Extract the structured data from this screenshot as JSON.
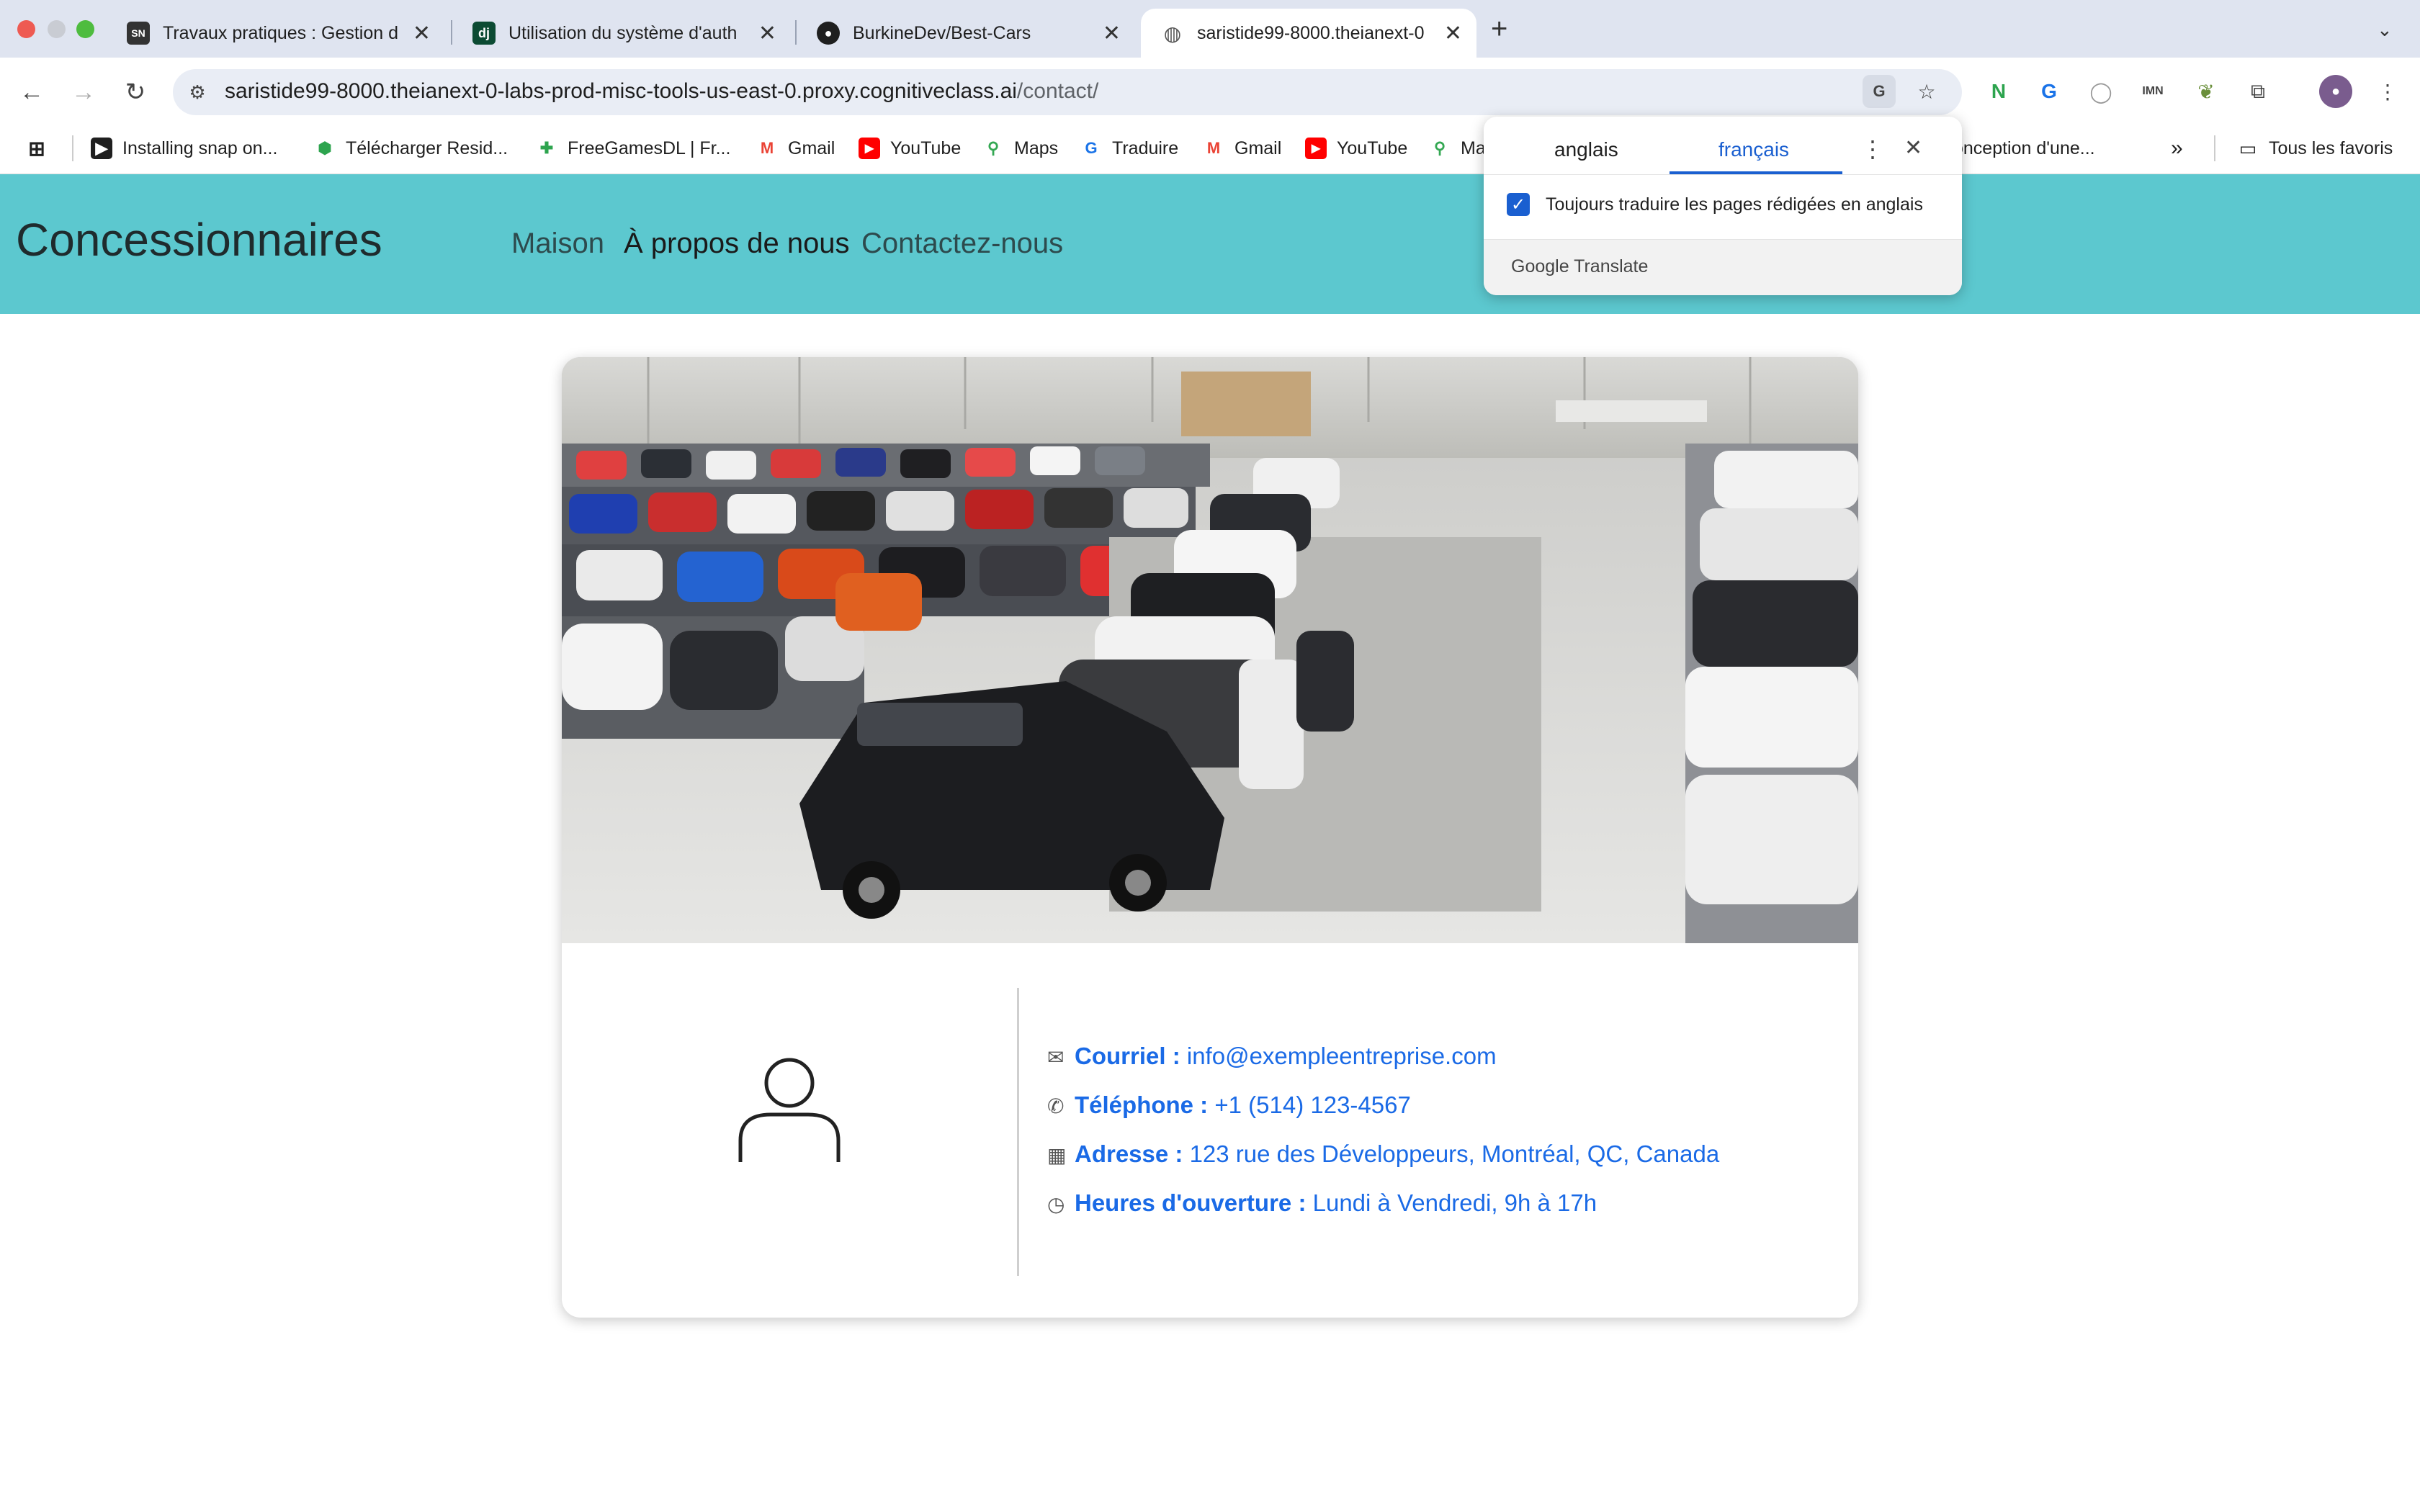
{
  "browser": {
    "tabs": [
      {
        "title": "Travaux pratiques : Gestion d",
        "icon": "skills-network-icon"
      },
      {
        "title": "Utilisation du système d'auth",
        "icon": "django-icon"
      },
      {
        "title": "BurkineDev/Best-Cars",
        "icon": "github-icon"
      },
      {
        "title": "saristide99-8000.theianext-0",
        "icon": "globe-icon",
        "active": true
      }
    ],
    "new_tab_symbol": "+",
    "url_host": "saristide99-8000.theianext-0-labs-prod-misc-tools-us-east-0.proxy.cognitiveclass.ai",
    "url_path": "/contact/",
    "bookmarks": [
      {
        "label": "Installing snap on...",
        "icon": "snapcraft-icon"
      },
      {
        "label": "Télécharger Resid...",
        "icon": "shield-icon"
      },
      {
        "label": "FreeGamesDL | Fr...",
        "icon": "gamepad-icon"
      },
      {
        "label": "Gmail",
        "icon": "gmail-icon"
      },
      {
        "label": "YouTube",
        "icon": "youtube-icon"
      },
      {
        "label": "Maps",
        "icon": "maps-icon"
      },
      {
        "label": "Traduire",
        "icon": "translate-icon"
      },
      {
        "label": "Gmail",
        "icon": "gmail-icon"
      },
      {
        "label": "YouTube",
        "icon": "youtube-icon"
      },
      {
        "label": "Ma",
        "icon": "maps-icon"
      },
      {
        "label": "onception d'une...",
        "icon": ""
      }
    ],
    "more_bookmarks": "»",
    "all_bookmarks": "Tous les favoris"
  },
  "translate_popup": {
    "source_lang": "anglais",
    "target_lang": "français",
    "always_translate": "Toujours traduire les pages rédigées en anglais",
    "always_translate_checked": true,
    "footer_google": "Google",
    "footer_translate": "Translate"
  },
  "site": {
    "brand": "Concessionnaires",
    "nav": [
      "Maison",
      "À propos de nous",
      "Contactez-nous"
    ],
    "header_color": "#5cc8cf"
  },
  "contact": {
    "email_label": "Courriel :",
    "email_value": "info@exempleentreprise.com",
    "phone_label": "Téléphone :",
    "phone_value": "+1 (514) 123-4567",
    "address_label": "Adresse :",
    "address_value": "123 rue des Développeurs, Montréal, QC, Canada",
    "hours_label": "Heures d'ouverture :",
    "hours_value": "Lundi à Vendredi, 9h à 17h",
    "accent_color": "#1a6ae6"
  }
}
